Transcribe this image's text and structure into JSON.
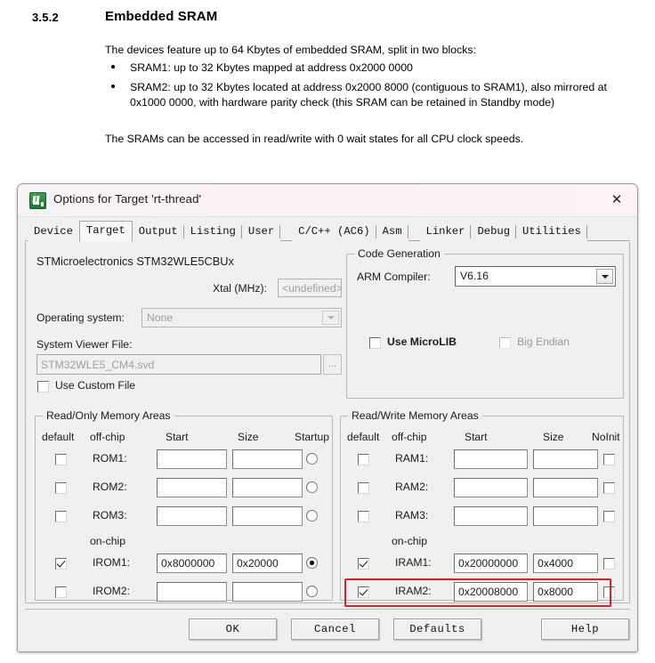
{
  "document": {
    "section_number": "3.5.2",
    "section_title": "Embedded SRAM",
    "intro": "The devices feature up to 64 Kbytes of embedded SRAM, split in two blocks:",
    "bullets": [
      "SRAM1: up to 32 Kbytes mapped at address 0x2000 0000",
      "SRAM2: up to 32 Kbytes located at address 0x2000 8000 (contiguous to SRAM1), also mirrored at 0x1000 0000, with hardware parity check (this SRAM can be retained in Standby mode)"
    ],
    "outro": "The SRAMs can be accessed in read/write with 0 wait states for all CPU clock speeds."
  },
  "dialog": {
    "title": "Options for Target 'rt-thread'",
    "close_label": "✕",
    "tabs": [
      {
        "label": "Device",
        "active": false
      },
      {
        "label": "Target",
        "active": true
      },
      {
        "label": "Output",
        "active": false
      },
      {
        "label": "Listing",
        "active": false
      },
      {
        "label": "User",
        "active": false
      },
      {
        "label": "C/C++ (AC6)",
        "active": false
      },
      {
        "label": "Asm",
        "active": false
      },
      {
        "label": "Linker",
        "active": false
      },
      {
        "label": "Debug",
        "active": false
      },
      {
        "label": "Utilities",
        "active": false
      }
    ],
    "device": {
      "vendor_part": "STMicroelectronics STM32WLE5CBUx",
      "xtal_label": "Xtal (MHz):",
      "xtal_value": "<undefined>",
      "os_label": "Operating system:",
      "os_value": "None",
      "svf_label": "System Viewer File:",
      "svf_value": "STM32WLE5_CM4.svd",
      "browse_label": "...",
      "use_custom_file_label": "Use Custom File",
      "use_custom_file_checked": false
    },
    "code_generation": {
      "group_title": "Code Generation",
      "compiler_label": "ARM Compiler:",
      "compiler_value": "V6.16",
      "microlib_label": "Use MicroLIB",
      "microlib_checked": false,
      "bigendian_label": "Big Endian",
      "bigendian_checked": false,
      "bigendian_disabled": true
    },
    "rom_areas": {
      "group_title": "Read/Only Memory Areas",
      "headers": {
        "default": "default",
        "offchip": "off-chip",
        "start": "Start",
        "size": "Size",
        "last": "Startup"
      },
      "onchip_label": "on-chip",
      "rows": [
        {
          "name": "ROM1:",
          "checked": false,
          "start": "",
          "size": "",
          "selected": false
        },
        {
          "name": "ROM2:",
          "checked": false,
          "start": "",
          "size": "",
          "selected": false
        },
        {
          "name": "ROM3:",
          "checked": false,
          "start": "",
          "size": "",
          "selected": false
        },
        {
          "name": "IROM1:",
          "checked": true,
          "start": "0x8000000",
          "size": "0x20000",
          "selected": true
        },
        {
          "name": "IROM2:",
          "checked": false,
          "start": "",
          "size": "",
          "selected": false
        }
      ]
    },
    "ram_areas": {
      "group_title": "Read/Write Memory Areas",
      "headers": {
        "default": "default",
        "offchip": "off-chip",
        "start": "Start",
        "size": "Size",
        "last": "NoInit"
      },
      "onchip_label": "on-chip",
      "rows": [
        {
          "name": "RAM1:",
          "checked": false,
          "start": "",
          "size": "",
          "noinit": false
        },
        {
          "name": "RAM2:",
          "checked": false,
          "start": "",
          "size": "",
          "noinit": false
        },
        {
          "name": "RAM3:",
          "checked": false,
          "start": "",
          "size": "",
          "noinit": false
        },
        {
          "name": "IRAM1:",
          "checked": true,
          "start": "0x20000000",
          "size": "0x4000",
          "noinit": false
        },
        {
          "name": "IRAM2:",
          "checked": true,
          "start": "0x20008000",
          "size": "0x8000",
          "noinit": false
        }
      ]
    },
    "buttons": {
      "ok": "OK",
      "cancel": "Cancel",
      "defaults": "Defaults",
      "help": "Help"
    },
    "highlight_color": "#e02020"
  }
}
